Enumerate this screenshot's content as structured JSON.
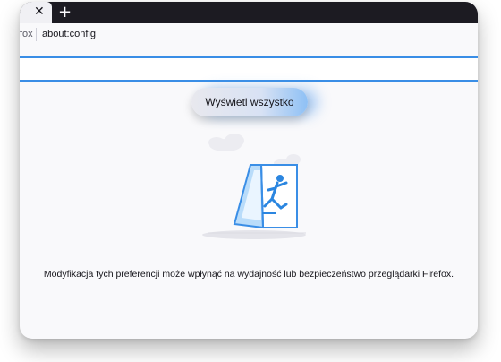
{
  "browser": {
    "tab_close_glyph": "✕",
    "new_tab_glyph": "+",
    "identity_label": "fox",
    "url": "about:config"
  },
  "search": {
    "value": "",
    "placeholder": ""
  },
  "main": {
    "show_all_label": "Wyświetl wszystko",
    "warning_text": "Modyfikacja tych preferencji może wpłynąć na wydajność lub bezpieczeństwo przeglądarki Firefox.",
    "illustration_icon": "falling-person-sign-icon"
  },
  "colors": {
    "accent": "#3a8ee6",
    "tabbar": "#1c1b22",
    "background": "#f9f9fb"
  }
}
